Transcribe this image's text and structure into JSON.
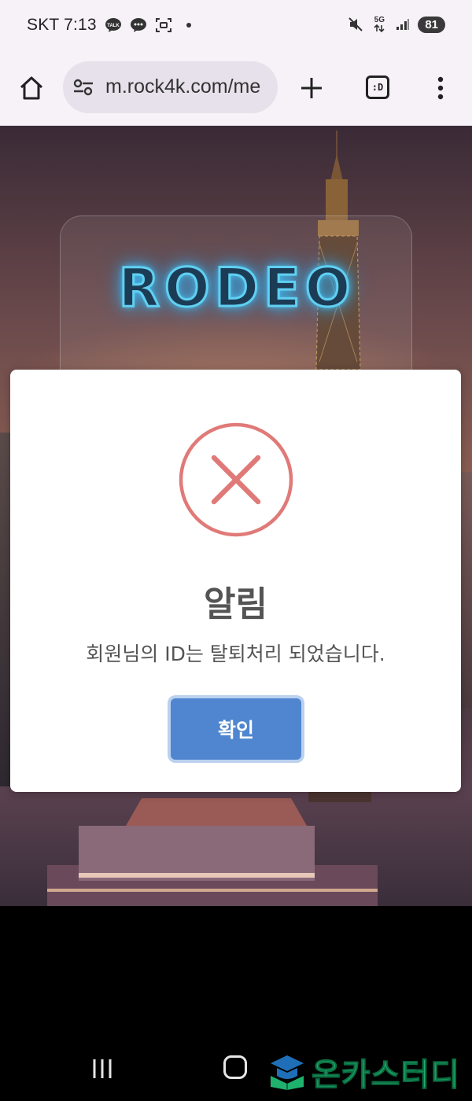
{
  "status_bar": {
    "carrier": "SKT",
    "time": "7:13",
    "network": "5G",
    "battery": "81",
    "icons": [
      "talk-icon",
      "chat-icon",
      "screenshot-icon",
      "dot-icon",
      "mute-icon",
      "data-arrows-icon",
      "signal-icon"
    ]
  },
  "browser": {
    "url": "m.rock4k.com/me",
    "tabs_label": ":D",
    "icons": [
      "home-icon",
      "site-settings-icon",
      "plus-icon",
      "tabs-icon",
      "more-vert-icon"
    ]
  },
  "page": {
    "logo": "RODEO"
  },
  "modal": {
    "icon": "error-x-icon",
    "title": "알림",
    "message": "회원님의 ID는 탈퇴처리 되었습니다.",
    "confirm_label": "확인",
    "accent_color": "#4f86cf",
    "error_color": "#e07a78"
  },
  "nav_bar": {
    "icons": [
      "recents-icon",
      "home-icon"
    ],
    "watermark": "온카스터디"
  }
}
